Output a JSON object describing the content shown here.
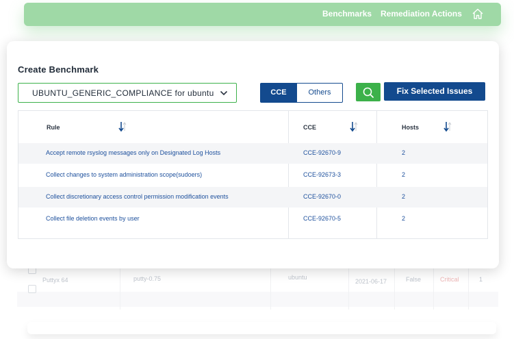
{
  "nav": {
    "benchmarks_label": "Benchmarks",
    "remediation_label": "Remediation Actions",
    "home_icon": "home-icon"
  },
  "modal": {
    "title": "Create Benchmark",
    "benchmark_select_value": "UBUNTU_GENERIC_COMPLIANCE for ubuntu",
    "toggle": {
      "cce_label": "CCE",
      "others_label": "Others",
      "active": "CCE"
    },
    "search_icon": "search-icon",
    "fix_button_label": "Fix Selected Issues",
    "table": {
      "headers": {
        "rule": "Rule",
        "cce": "CCE",
        "hosts": "Hosts"
      },
      "rows": [
        {
          "rule": "Accept remote rsyslog messages only on Designated Log Hosts",
          "cce": "CCE-92670-9",
          "hosts": "2"
        },
        {
          "rule": "Collect changes to system administration scope(sudoers)",
          "cce": "CCE-92673-3",
          "hosts": "2"
        },
        {
          "rule": "Collect discretionary access control permission modification events",
          "cce": "CCE-92670-0",
          "hosts": "2"
        },
        {
          "rule": "Collect file deletion events by user",
          "cce": "CCE-92670-5",
          "hosts": "2"
        }
      ]
    }
  },
  "background_table": {
    "row": {
      "name": "Puttyx 64",
      "package": "putty-0.75",
      "os": "ubuntu",
      "date": "2021-06-17",
      "flag": "False",
      "severity": "Critical",
      "count": "1"
    }
  },
  "colors": {
    "brand_green": "#3cb14a",
    "nav_green": "#9fd9a6",
    "primary_blue": "#134a8e",
    "link_blue": "#1c4f9c",
    "critical_red": "#e07a7a"
  }
}
